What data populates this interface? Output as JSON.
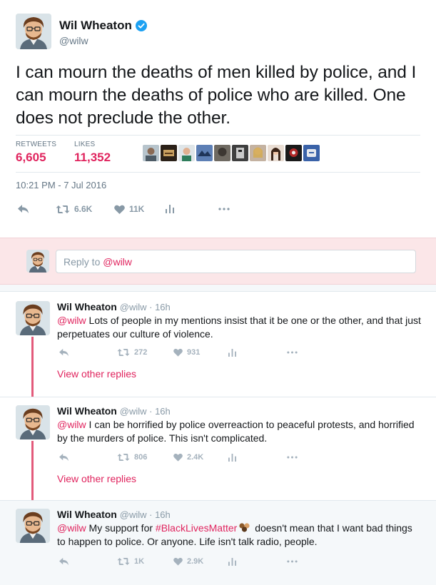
{
  "main": {
    "author_name": "Wil Wheaton",
    "handle": "@wilw",
    "text": "I can mourn the deaths of men killed by police, and I can mourn the deaths of police who are killed. One does not preclude the other.",
    "retweets_label": "RETWEETS",
    "retweets_value": "6,605",
    "likes_label": "LIKES",
    "likes_value": "11,352",
    "timestamp": "10:21 PM - 7 Jul 2016",
    "actions": {
      "retweet_count": "6.6K",
      "like_count": "11K"
    }
  },
  "reply_box": {
    "prefix": "Reply to ",
    "mention": "@wilw"
  },
  "replies": [
    {
      "name": "Wil Wheaton",
      "meta": "@wilw · 16h",
      "mention": "@wilw",
      "text": " Lots of people in my mentions insist that it be one or the other, and that just perpetuates our culture of violence.",
      "retweet_count": "272",
      "like_count": "931",
      "view_other": "View other replies"
    },
    {
      "name": "Wil Wheaton",
      "meta": "@wilw · 16h",
      "mention": "@wilw",
      "text": " I can be horrified by police overreaction to peaceful protests, and horrified by the murders of police. This isn't complicated.",
      "retweet_count": "806",
      "like_count": "2.4K",
      "view_other": "View other replies"
    },
    {
      "name": "Wil Wheaton",
      "meta": "@wilw · 16h",
      "mention": "@wilw",
      "text_a": " My support for ",
      "hashtag": "#BlackLivesMatter",
      "text_b": " doesn't mean that I want bad things to happen to police. Or anyone. Life isn't talk radio, people.",
      "retweet_count": "1K",
      "like_count": "2.9K"
    }
  ],
  "icons": [
    "verified-badge-icon",
    "reply-icon",
    "retweet-icon",
    "heart-icon",
    "analytics-icon",
    "more-icon",
    "hashtag-emoji-icon"
  ],
  "colors": {
    "accent": "#e0245e",
    "thread_line": "#e35a7b",
    "verified": "#1da1f2",
    "reply_box_bg": "#fbe6e8",
    "muted": "#8899a6"
  }
}
